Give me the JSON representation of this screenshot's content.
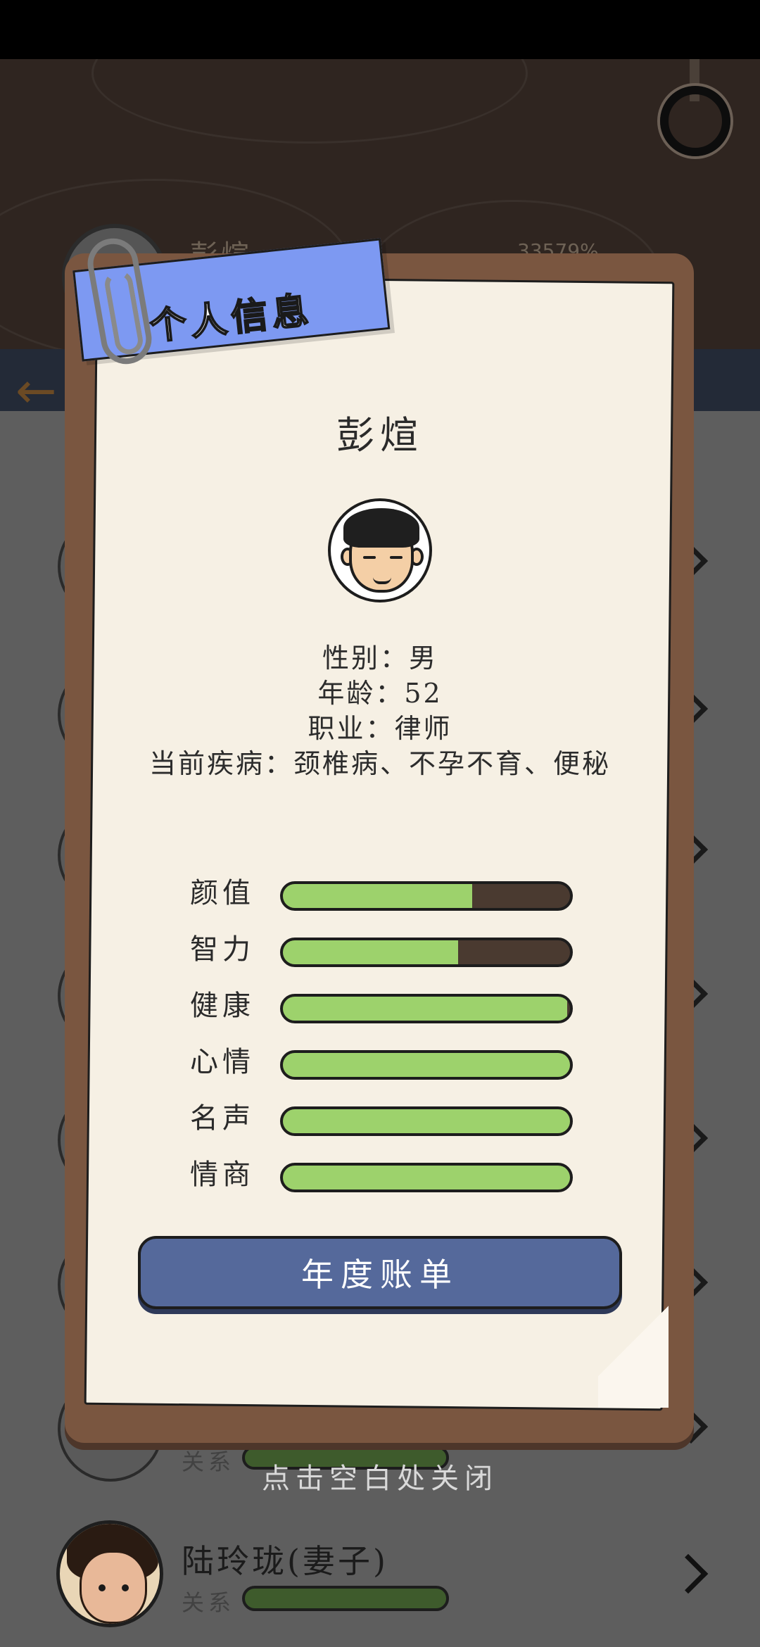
{
  "background": {
    "top_name": "彭煊",
    "money": "33579%",
    "list_row": {
      "name": "陆玲珑(妻子)",
      "relation_label": "关系"
    },
    "hidden_relation_label": "关系"
  },
  "modal": {
    "title": "个人信息",
    "name": "彭煊",
    "info": {
      "gender": "性别：男",
      "age": "年龄：52",
      "job": "职业：律师",
      "illness": "当前疾病：颈椎病、不孕不育、便秘"
    },
    "stats": [
      {
        "label": "颜值",
        "value": 0.66
      },
      {
        "label": "智力",
        "value": 0.61
      },
      {
        "label": "健康",
        "value": 0.99
      },
      {
        "label": "心情",
        "value": 1.0
      },
      {
        "label": "名声",
        "value": 1.0
      },
      {
        "label": "情商",
        "value": 1.0
      }
    ],
    "button_label": "年度账单"
  },
  "close_hint": "点击空白处关闭",
  "colors": {
    "bar_fill": "#9dd26c",
    "bar_empty": "#4a3a30",
    "ribbon": "#7d99f2",
    "button": "#55699b"
  }
}
